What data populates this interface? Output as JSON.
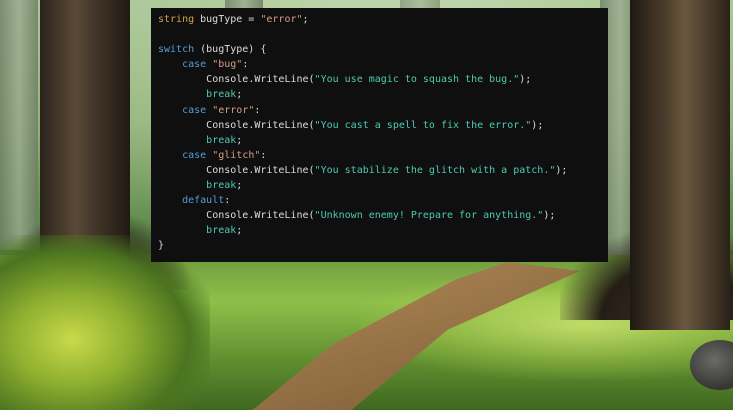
{
  "code": {
    "line1": {
      "type": "string",
      "rest1": " bugType = ",
      "value": "\"error\"",
      "end": ";"
    },
    "line3": {
      "kw": "switch",
      "rest": " (bugType) {"
    },
    "case1": {
      "kw": "case",
      "value": "\"bug\"",
      "colon": ":"
    },
    "case1_body": {
      "call": "Console.WriteLine(",
      "msg": "\"You use magic to squash the bug.\"",
      "end": ");"
    },
    "case2": {
      "kw": "case",
      "value": "\"error\"",
      "colon": ":"
    },
    "case2_body": {
      "call": "Console.WriteLine(",
      "msg": "\"You cast a spell to fix the error.\"",
      "end": ");"
    },
    "case3": {
      "kw": "case",
      "value": "\"glitch\"",
      "colon": ":"
    },
    "case3_body": {
      "call": "Console.WriteLine(",
      "msg": "\"You stabilize the glitch with a patch.\"",
      "end": ");"
    },
    "default": {
      "kw": "default",
      "colon": ":"
    },
    "default_body": {
      "call": "Console.WriteLine(",
      "msg": "\"Unknown enemy! Prepare for anything.\"",
      "end": ");"
    },
    "break_kw": "break",
    "semicolon": ";",
    "closing": "}"
  }
}
